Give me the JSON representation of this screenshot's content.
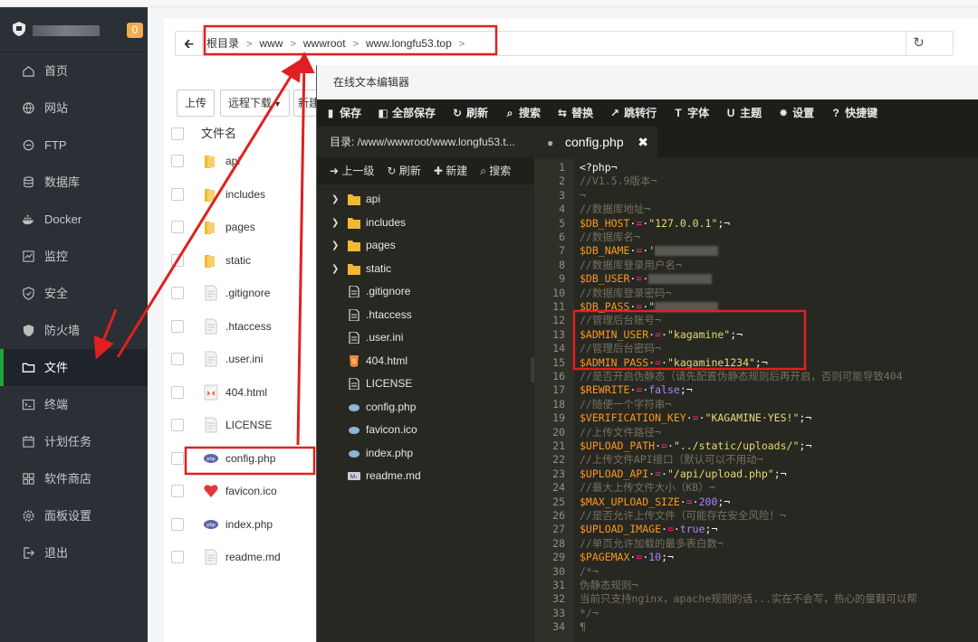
{
  "sidebar": {
    "badge": "0",
    "items": [
      {
        "label": "首页",
        "icon": "home-icon"
      },
      {
        "label": "网站",
        "icon": "globe-icon"
      },
      {
        "label": "FTP",
        "icon": "ftp-icon"
      },
      {
        "label": "数据库",
        "icon": "database-icon"
      },
      {
        "label": "Docker",
        "icon": "docker-icon"
      },
      {
        "label": "监控",
        "icon": "monitor-icon"
      },
      {
        "label": "安全",
        "icon": "shield-icon"
      },
      {
        "label": "防火墙",
        "icon": "firewall-icon"
      },
      {
        "label": "文件",
        "icon": "folder-icon",
        "active": true
      },
      {
        "label": "终端",
        "icon": "terminal-icon"
      },
      {
        "label": "计划任务",
        "icon": "calendar-icon"
      },
      {
        "label": "软件商店",
        "icon": "grid-icon"
      },
      {
        "label": "面板设置",
        "icon": "gear-icon"
      },
      {
        "label": "退出",
        "icon": "logout-icon"
      }
    ]
  },
  "file_manager": {
    "breadcrumb": [
      "根目录",
      "www",
      "wwwroot",
      "www.longfu53.top"
    ],
    "buttons": {
      "upload": "上传",
      "remote_download": "远程下载",
      "new_partial": "新建"
    },
    "header_name": "文件名",
    "files": [
      {
        "name": "api",
        "type": "folder"
      },
      {
        "name": "includes",
        "type": "folder"
      },
      {
        "name": "pages",
        "type": "folder"
      },
      {
        "name": "static",
        "type": "folder"
      },
      {
        "name": ".gitignore",
        "type": "file"
      },
      {
        "name": ".htaccess",
        "type": "file"
      },
      {
        "name": ".user.ini",
        "type": "file"
      },
      {
        "name": "404.html",
        "type": "html"
      },
      {
        "name": "LICENSE",
        "type": "file"
      },
      {
        "name": "config.php",
        "type": "php"
      },
      {
        "name": "favicon.ico",
        "type": "ico"
      },
      {
        "name": "index.php",
        "type": "php"
      },
      {
        "name": "readme.md",
        "type": "file"
      }
    ]
  },
  "editor": {
    "title": "在线文本编辑器",
    "toolbar": [
      "保存",
      "全部保存",
      "刷新",
      "搜索",
      "替换",
      "跳转行",
      "字体",
      "主题",
      "设置",
      "快捷键"
    ],
    "dir_label": "目录: /www/wwwroot/www.longfu53.t...",
    "side_actions": [
      "上一级",
      "刷新",
      "新建",
      "搜索"
    ],
    "tree": [
      {
        "name": "api",
        "type": "folder"
      },
      {
        "name": "includes",
        "type": "folder"
      },
      {
        "name": "pages",
        "type": "folder"
      },
      {
        "name": "static",
        "type": "folder"
      },
      {
        "name": ".gitignore",
        "type": "file"
      },
      {
        "name": ".htaccess",
        "type": "file"
      },
      {
        "name": ".user.ini",
        "type": "file"
      },
      {
        "name": "404.html",
        "type": "html"
      },
      {
        "name": "LICENSE",
        "type": "file"
      },
      {
        "name": "config.php",
        "type": "php"
      },
      {
        "name": "favicon.ico",
        "type": "php"
      },
      {
        "name": "index.php",
        "type": "php"
      },
      {
        "name": "readme.md",
        "type": "md"
      }
    ],
    "tab_name": "config.php",
    "code": [
      [
        [
          "n",
          "<?php¬"
        ]
      ],
      [
        [
          "c",
          "//V1.5.9版本¬"
        ]
      ],
      [
        [
          "c",
          "¬"
        ]
      ],
      [
        [
          "c",
          "//数据库地址¬"
        ]
      ],
      [
        [
          "v",
          "$DB_HOST"
        ],
        [
          "n",
          "·"
        ],
        [
          "o",
          "="
        ],
        [
          "n",
          "·"
        ],
        [
          "s",
          "\"127.0.0.1\""
        ],
        [
          "n",
          ";¬"
        ]
      ],
      [
        [
          "c",
          "//数据库名¬"
        ]
      ],
      [
        [
          "v",
          "$DB_NAME"
        ],
        [
          "n",
          "·"
        ],
        [
          "o",
          "="
        ],
        [
          "n",
          "·"
        ],
        [
          "s",
          "'"
        ],
        [
          "b",
          ""
        ]
      ],
      [
        [
          "c",
          "//数据库登录用户名¬"
        ]
      ],
      [
        [
          "v",
          "$DB_USER"
        ],
        [
          "n",
          "·"
        ],
        [
          "o",
          "="
        ],
        [
          "n",
          "·"
        ],
        [
          "b",
          ""
        ]
      ],
      [
        [
          "c",
          "//数据库登录密码¬"
        ]
      ],
      [
        [
          "v",
          "$DB_PASS"
        ],
        [
          "n",
          "·"
        ],
        [
          "o",
          "="
        ],
        [
          "n",
          "·"
        ],
        [
          "s",
          "\""
        ],
        [
          "b",
          ""
        ]
      ],
      [
        [
          "c",
          "//管理后台账号¬"
        ]
      ],
      [
        [
          "v",
          "$ADMIN_USER"
        ],
        [
          "n",
          "·"
        ],
        [
          "o",
          "="
        ],
        [
          "n",
          "·"
        ],
        [
          "s",
          "\"kagamine\""
        ],
        [
          "n",
          ";¬"
        ]
      ],
      [
        [
          "c",
          "//管理后台密码¬"
        ]
      ],
      [
        [
          "v",
          "$ADMIN_PASS"
        ],
        [
          "n",
          "·"
        ],
        [
          "o",
          "="
        ],
        [
          "n",
          "·"
        ],
        [
          "s",
          "\"kagamine1234\""
        ],
        [
          "n",
          ";¬"
        ]
      ],
      [
        [
          "c",
          "//是否开启伪静态（请先配置伪静态规则后再开启，否则可能导致404"
        ]
      ],
      [
        [
          "v",
          "$REWRITE"
        ],
        [
          "n",
          "·"
        ],
        [
          "o",
          "="
        ],
        [
          "n",
          "·"
        ],
        [
          "u",
          "false"
        ],
        [
          "n",
          ";¬"
        ]
      ],
      [
        [
          "c",
          "//随便一个字符串¬"
        ]
      ],
      [
        [
          "v",
          "$VERIFICATION_KEY"
        ],
        [
          "n",
          "·"
        ],
        [
          "o",
          "="
        ],
        [
          "n",
          "·"
        ],
        [
          "s",
          "\"KAGAMINE·YES!\""
        ],
        [
          "n",
          ";¬"
        ]
      ],
      [
        [
          "c",
          "//上传文件路径¬"
        ]
      ],
      [
        [
          "v",
          "$UPLOAD_PATH"
        ],
        [
          "n",
          "·"
        ],
        [
          "o",
          "="
        ],
        [
          "n",
          "·"
        ],
        [
          "s",
          "\"../static/uploads/\""
        ],
        [
          "n",
          ";¬"
        ]
      ],
      [
        [
          "c",
          "//上传文件API接口（默认可以不用动¬"
        ]
      ],
      [
        [
          "v",
          "$UPLOAD_API"
        ],
        [
          "n",
          "·"
        ],
        [
          "o",
          "="
        ],
        [
          "n",
          "·"
        ],
        [
          "s",
          "\"/api/upload.php\""
        ],
        [
          "n",
          ";¬"
        ]
      ],
      [
        [
          "c",
          "//最大上传文件大小（KB）¬"
        ]
      ],
      [
        [
          "v",
          "$MAX_UPLOAD_SIZE"
        ],
        [
          "n",
          "·"
        ],
        [
          "o",
          "="
        ],
        [
          "n",
          "·"
        ],
        [
          "u",
          "200"
        ],
        [
          "n",
          ";¬"
        ]
      ],
      [
        [
          "c",
          "//是否允许上传文件（可能存在安全风险！¬"
        ]
      ],
      [
        [
          "v",
          "$UPLOAD_IMAGE"
        ],
        [
          "n",
          "·"
        ],
        [
          "o",
          "="
        ],
        [
          "n",
          "·"
        ],
        [
          "u",
          "true"
        ],
        [
          "n",
          ";¬"
        ]
      ],
      [
        [
          "c",
          "//单页允许加载的最多表白数¬"
        ]
      ],
      [
        [
          "v",
          "$PAGEMAX"
        ],
        [
          "n",
          "·"
        ],
        [
          "o",
          "="
        ],
        [
          "n",
          "·"
        ],
        [
          "u",
          "10"
        ],
        [
          "n",
          ";¬"
        ]
      ],
      [
        [
          "c",
          "/*¬"
        ]
      ],
      [
        [
          "c",
          "伪静态规则¬"
        ]
      ],
      [
        [
          "c",
          "当前只支持nginx，apache规则的话...实在不会写，热心的童鞋可以帮"
        ]
      ],
      [
        [
          "c",
          "*/¬"
        ]
      ],
      [
        [
          "c",
          "¶"
        ]
      ]
    ]
  },
  "colors": {
    "sidebar_bg": "#2b2f36",
    "accent_green": "#20a53a",
    "annotation_red": "#e02020",
    "editor_bg": "#272822"
  }
}
